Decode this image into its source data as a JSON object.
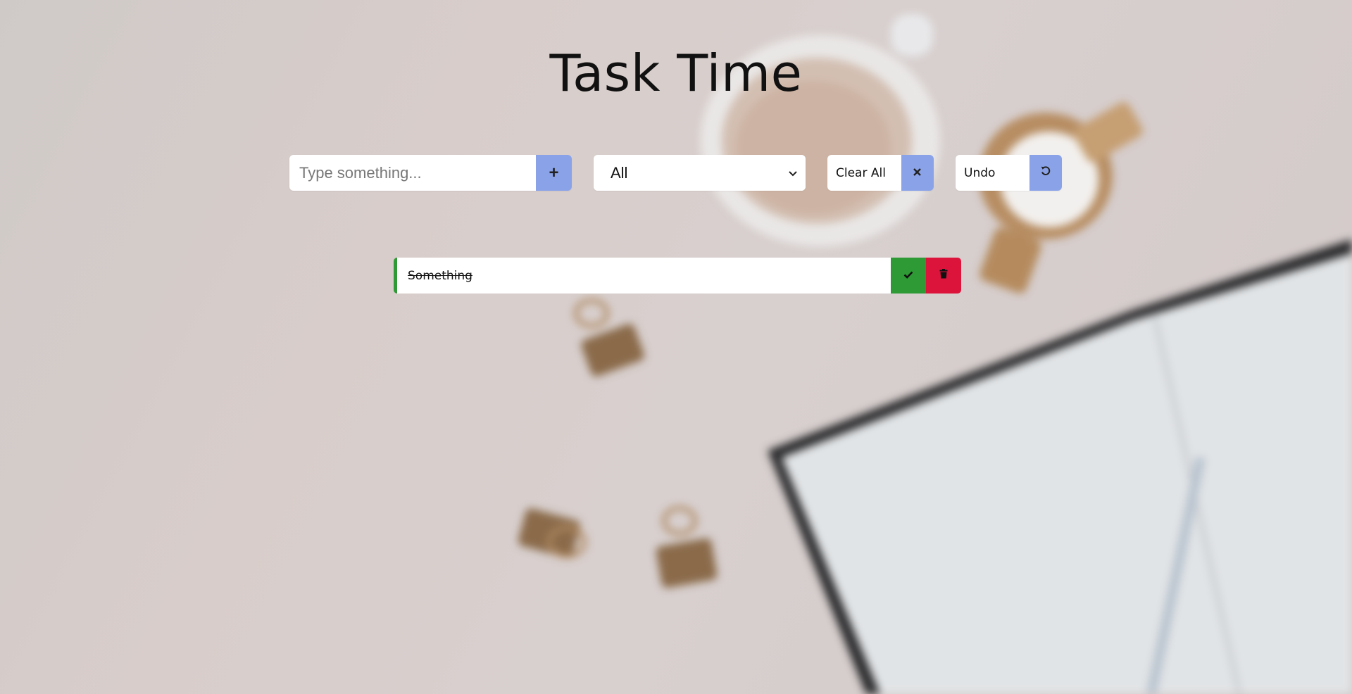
{
  "app": {
    "title": "Task Time"
  },
  "controls": {
    "add_placeholder": "Type something...",
    "add_icon": "plus-icon",
    "filter_value": "All",
    "clear_label": "Clear All",
    "clear_icon": "x-icon",
    "undo_label": "Undo",
    "undo_icon": "rotate-left-icon"
  },
  "tasks": [
    {
      "text": "Something",
      "completed": true
    }
  ],
  "colors": {
    "accent": "#8aa3e8",
    "complete": "#2e9a35",
    "delete": "#dc143c"
  }
}
